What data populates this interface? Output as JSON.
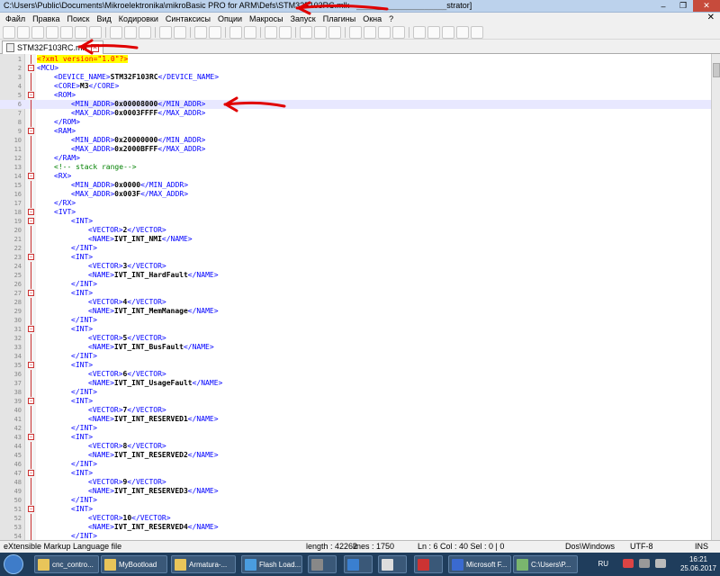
{
  "window": {
    "title": "C:\\Users\\Public\\Documents\\Mikroelektronika\\mikroBasic PRO for ARM\\Defs\\STM32F103RC.mlk -",
    "title_suffix": "strator]"
  },
  "menu": [
    "Файл",
    "Правка",
    "Поиск",
    "Вид",
    "Кодировки",
    "Синтаксисы",
    "Опции",
    "Макросы",
    "Запуск",
    "Плагины",
    "Окна",
    "?"
  ],
  "tab": {
    "label": "STM32F103RC.mlk"
  },
  "editor": {
    "lines": [
      {
        "n": "1",
        "t": "decl",
        "i": 0,
        "v": "<?xml version=\"1.0\"?>"
      },
      {
        "n": "2",
        "t": "tag",
        "i": 0,
        "v": "<MCU>"
      },
      {
        "n": "3",
        "t": "pair",
        "i": 1,
        "o": "<DEVICE_NAME>",
        "x": "STM32F103RC",
        "c": "</DEVICE_NAME>"
      },
      {
        "n": "4",
        "t": "pair",
        "i": 1,
        "o": "<CORE>",
        "x": "M3",
        "c": "</CORE>"
      },
      {
        "n": "5",
        "t": "tag",
        "i": 1,
        "v": "<ROM>"
      },
      {
        "n": "6",
        "t": "pair",
        "i": 2,
        "o": "<MIN_ADDR>",
        "x": "0x00008000",
        "c": "</MIN_ADDR>"
      },
      {
        "n": "7",
        "t": "pair",
        "i": 2,
        "o": "<MAX_ADDR>",
        "x": "0x0003FFFF",
        "c": "</MAX_ADDR>"
      },
      {
        "n": "8",
        "t": "tag",
        "i": 1,
        "v": "</ROM>"
      },
      {
        "n": "9",
        "t": "tag",
        "i": 1,
        "v": "<RAM>"
      },
      {
        "n": "10",
        "t": "pair",
        "i": 2,
        "o": "<MIN_ADDR>",
        "x": "0x20000000",
        "c": "</MIN_ADDR>"
      },
      {
        "n": "11",
        "t": "pair",
        "i": 2,
        "o": "<MAX_ADDR>",
        "x": "0x2000BFFF",
        "c": "</MAX_ADDR>"
      },
      {
        "n": "12",
        "t": "tag",
        "i": 1,
        "v": "</RAM>"
      },
      {
        "n": "13",
        "t": "cmt",
        "i": 1,
        "v": "<!-- stack range-->"
      },
      {
        "n": "14",
        "t": "tag",
        "i": 1,
        "v": "<RX>"
      },
      {
        "n": "15",
        "t": "pair",
        "i": 2,
        "o": "<MIN_ADDR>",
        "x": "0x0000",
        "c": "</MIN_ADDR>"
      },
      {
        "n": "16",
        "t": "pair",
        "i": 2,
        "o": "<MAX_ADDR>",
        "x": "0x003F",
        "c": "</MAX_ADDR>"
      },
      {
        "n": "17",
        "t": "tag",
        "i": 1,
        "v": "</RX>"
      },
      {
        "n": "18",
        "t": "tag",
        "i": 1,
        "v": "<IVT>"
      },
      {
        "n": "19",
        "t": "tag",
        "i": 2,
        "v": "<INT>"
      },
      {
        "n": "20",
        "t": "pair",
        "i": 3,
        "o": "<VECTOR>",
        "x": "2",
        "c": "</VECTOR>"
      },
      {
        "n": "21",
        "t": "pair",
        "i": 3,
        "o": "<NAME>",
        "x": "IVT_INT_NMI",
        "c": "</NAME>"
      },
      {
        "n": "22",
        "t": "tag",
        "i": 2,
        "v": "</INT>"
      },
      {
        "n": "23",
        "t": "tag",
        "i": 2,
        "v": "<INT>"
      },
      {
        "n": "24",
        "t": "pair",
        "i": 3,
        "o": "<VECTOR>",
        "x": "3",
        "c": "</VECTOR>"
      },
      {
        "n": "25",
        "t": "pair",
        "i": 3,
        "o": "<NAME>",
        "x": "IVT_INT_HardFault",
        "c": "</NAME>"
      },
      {
        "n": "26",
        "t": "tag",
        "i": 2,
        "v": "</INT>"
      },
      {
        "n": "27",
        "t": "tag",
        "i": 2,
        "v": "<INT>"
      },
      {
        "n": "28",
        "t": "pair",
        "i": 3,
        "o": "<VECTOR>",
        "x": "4",
        "c": "</VECTOR>"
      },
      {
        "n": "29",
        "t": "pair",
        "i": 3,
        "o": "<NAME>",
        "x": "IVT_INT_MemManage",
        "c": "</NAME>"
      },
      {
        "n": "30",
        "t": "tag",
        "i": 2,
        "v": "</INT>"
      },
      {
        "n": "31",
        "t": "tag",
        "i": 2,
        "v": "<INT>"
      },
      {
        "n": "32",
        "t": "pair",
        "i": 3,
        "o": "<VECTOR>",
        "x": "5",
        "c": "</VECTOR>"
      },
      {
        "n": "33",
        "t": "pair",
        "i": 3,
        "o": "<NAME>",
        "x": "IVT_INT_BusFault",
        "c": "</NAME>"
      },
      {
        "n": "34",
        "t": "tag",
        "i": 2,
        "v": "</INT>"
      },
      {
        "n": "35",
        "t": "tag",
        "i": 2,
        "v": "<INT>"
      },
      {
        "n": "36",
        "t": "pair",
        "i": 3,
        "o": "<VECTOR>",
        "x": "6",
        "c": "</VECTOR>"
      },
      {
        "n": "37",
        "t": "pair",
        "i": 3,
        "o": "<NAME>",
        "x": "IVT_INT_UsageFault",
        "c": "</NAME>"
      },
      {
        "n": "38",
        "t": "tag",
        "i": 2,
        "v": "</INT>"
      },
      {
        "n": "39",
        "t": "tag",
        "i": 2,
        "v": "<INT>"
      },
      {
        "n": "40",
        "t": "pair",
        "i": 3,
        "o": "<VECTOR>",
        "x": "7",
        "c": "</VECTOR>"
      },
      {
        "n": "41",
        "t": "pair",
        "i": 3,
        "o": "<NAME>",
        "x": "IVT_INT_RESERVED1",
        "c": "</NAME>"
      },
      {
        "n": "42",
        "t": "tag",
        "i": 2,
        "v": "</INT>"
      },
      {
        "n": "43",
        "t": "tag",
        "i": 2,
        "v": "<INT>"
      },
      {
        "n": "44",
        "t": "pair",
        "i": 3,
        "o": "<VECTOR>",
        "x": "8",
        "c": "</VECTOR>"
      },
      {
        "n": "45",
        "t": "pair",
        "i": 3,
        "o": "<NAME>",
        "x": "IVT_INT_RESERVED2",
        "c": "</NAME>"
      },
      {
        "n": "46",
        "t": "tag",
        "i": 2,
        "v": "</INT>"
      },
      {
        "n": "47",
        "t": "tag",
        "i": 2,
        "v": "<INT>"
      },
      {
        "n": "48",
        "t": "pair",
        "i": 3,
        "o": "<VECTOR>",
        "x": "9",
        "c": "</VECTOR>"
      },
      {
        "n": "49",
        "t": "pair",
        "i": 3,
        "o": "<NAME>",
        "x": "IVT_INT_RESERVED3",
        "c": "</NAME>"
      },
      {
        "n": "50",
        "t": "tag",
        "i": 2,
        "v": "</INT>"
      },
      {
        "n": "51",
        "t": "tag",
        "i": 2,
        "v": "<INT>"
      },
      {
        "n": "52",
        "t": "pair",
        "i": 3,
        "o": "<VECTOR>",
        "x": "10",
        "c": "</VECTOR>"
      },
      {
        "n": "53",
        "t": "pair",
        "i": 3,
        "o": "<NAME>",
        "x": "IVT_INT_RESERVED4",
        "c": "</NAME>"
      },
      {
        "n": "54",
        "t": "tag",
        "i": 2,
        "v": "</INT>"
      }
    ],
    "current_line": "6",
    "fold_lines": [
      "2",
      "5",
      "9",
      "14",
      "18",
      "19",
      "23",
      "27",
      "31",
      "35",
      "39",
      "43",
      "47",
      "51"
    ]
  },
  "status": {
    "filetype": "eXtensible Markup Language file",
    "length": "length : 42262",
    "lines": "lines : 1750",
    "pos": "Ln : 6   Col : 40   Sel : 0 | 0",
    "eol": "Dos\\Windows",
    "encoding": "UTF-8",
    "mode": "INS"
  },
  "taskbar": {
    "items": [
      "cnc_contro...",
      "MyBootload",
      "Armatura-...",
      "Flash Load...",
      "Microsoft F...",
      "C:\\Users\\P..."
    ],
    "lang": "RU",
    "time": "16:21",
    "date": "25.06.2017"
  },
  "colors": {
    "annotation": "#e00000",
    "tag": "#0000ff",
    "comment": "#008000"
  }
}
